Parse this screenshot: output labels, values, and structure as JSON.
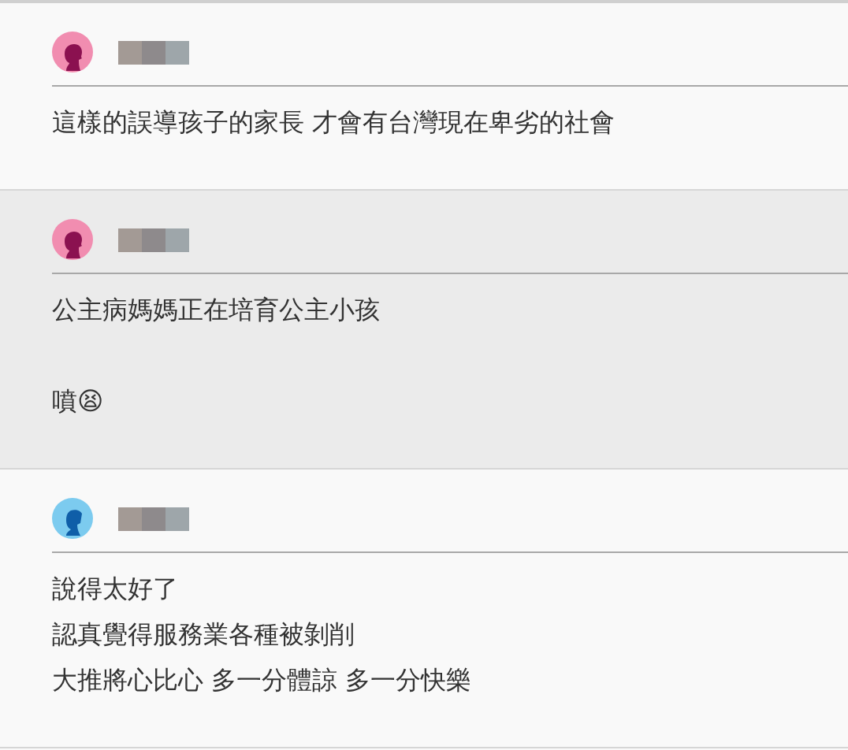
{
  "comments": [
    {
      "avatar": {
        "kind": "female"
      },
      "highlighted": false,
      "paragraphs": [
        [
          "這樣的誤導孩子的家長 才會有台灣現在卑劣的社會"
        ]
      ]
    },
    {
      "avatar": {
        "kind": "female"
      },
      "highlighted": true,
      "paragraphs": [
        [
          "公主病媽媽正在培育公主小孩"
        ],
        [
          "噴😫"
        ]
      ]
    },
    {
      "avatar": {
        "kind": "male"
      },
      "highlighted": false,
      "paragraphs": [
        [
          "說得太好了",
          "認真覺得服務業各種被剝削",
          "大推將心比心 多一分體諒 多一分快樂"
        ]
      ]
    }
  ]
}
